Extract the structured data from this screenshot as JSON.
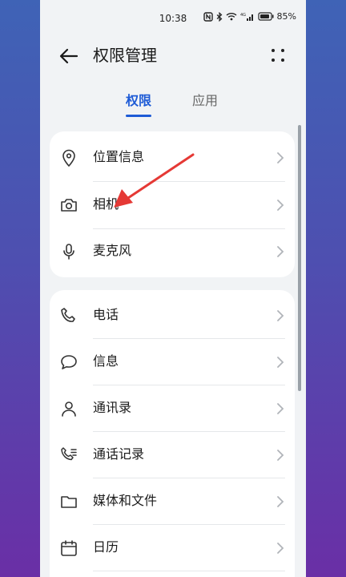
{
  "status_bar": {
    "time": "10:38",
    "battery_percent": "85%",
    "signal_label": "4G"
  },
  "header": {
    "title": "权限管理"
  },
  "tabs": [
    {
      "label": "权限",
      "active": true
    },
    {
      "label": "应用",
      "active": false
    }
  ],
  "groups": [
    {
      "items": [
        {
          "label": "位置信息",
          "icon": "location-pin-icon"
        },
        {
          "label": "相机",
          "icon": "camera-icon"
        },
        {
          "label": "麦克风",
          "icon": "microphone-icon"
        }
      ]
    },
    {
      "items": [
        {
          "label": "电话",
          "icon": "phone-icon"
        },
        {
          "label": "信息",
          "icon": "message-bubble-icon"
        },
        {
          "label": "通讯录",
          "icon": "contacts-icon"
        },
        {
          "label": "通话记录",
          "icon": "call-log-icon"
        },
        {
          "label": "媒体和文件",
          "icon": "folder-icon"
        },
        {
          "label": "日历",
          "icon": "calendar-icon"
        }
      ]
    }
  ],
  "colors": {
    "accent": "#1e5bd6",
    "annotation_arrow": "#e53935"
  }
}
